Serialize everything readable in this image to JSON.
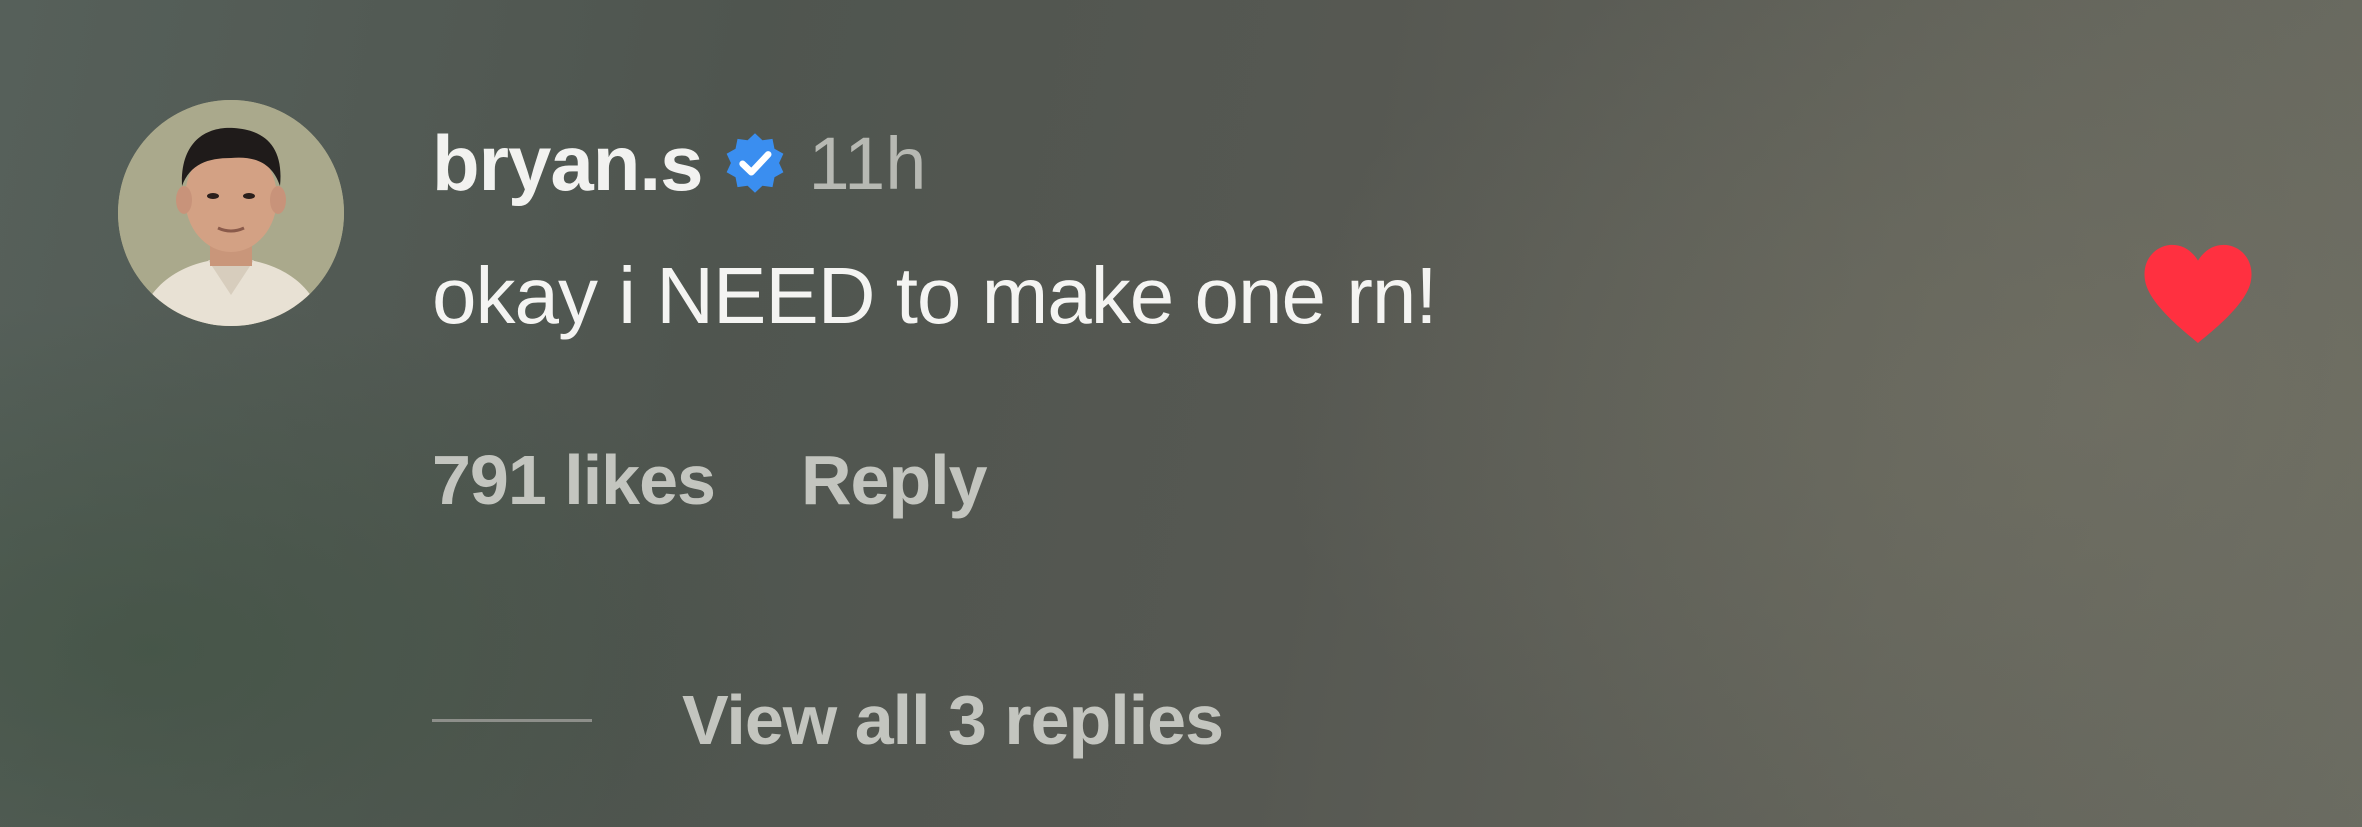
{
  "comment": {
    "username": "bryan.s",
    "verified": true,
    "timestamp": "11h",
    "text": "okay i NEED to make one rn!",
    "liked": true,
    "likes_label": "791 likes",
    "reply_label": "Reply",
    "view_replies_label": "View all 3 replies"
  },
  "icons": {
    "verified": "verified-badge-icon",
    "like": "heart-icon"
  },
  "colors": {
    "verified_blue": "#3a8ef0",
    "heart_red": "#ff3040",
    "text_primary": "#f2f2f0",
    "text_secondary": "#c3c5bf"
  }
}
